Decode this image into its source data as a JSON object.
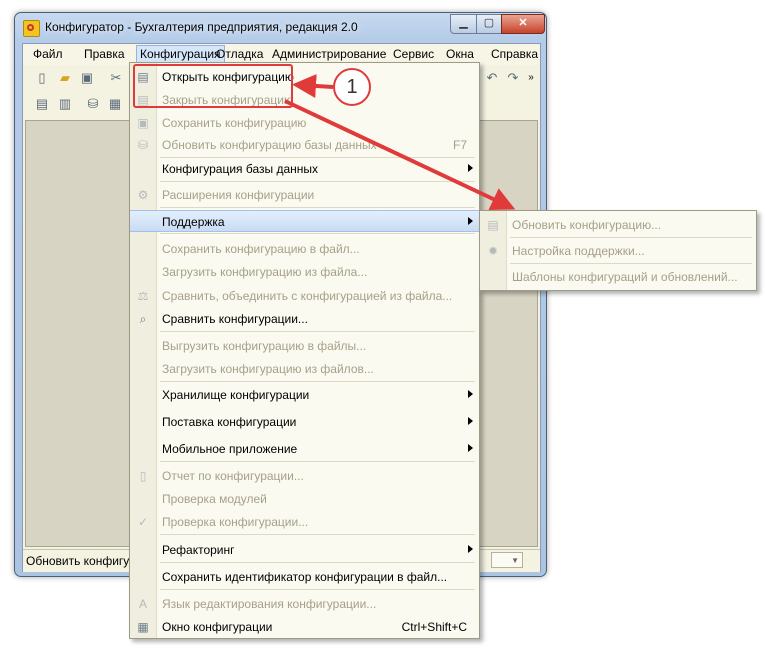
{
  "window": {
    "title": "Конфигуратор - Бухгалтерия предприятия, редакция 2.0"
  },
  "menubar": [
    {
      "label": "Файл",
      "active": false
    },
    {
      "label": "Правка",
      "active": false
    },
    {
      "label": "Конфигурация",
      "active": true
    },
    {
      "label": "Отладка",
      "active": false
    },
    {
      "label": "Администрирование",
      "active": false
    },
    {
      "label": "Сервис",
      "active": false
    },
    {
      "label": "Окна",
      "active": false
    },
    {
      "label": "Справка",
      "active": false
    }
  ],
  "config_menu": {
    "items": [
      {
        "label": "Открыть конфигурацию",
        "disabled": false,
        "icon": "open-config-icon",
        "glyph": "▤"
      },
      {
        "label": "Закрыть конфигурацию",
        "disabled": true,
        "icon": "close-config-icon",
        "glyph": "▤"
      },
      {
        "label": "Сохранить конфигурацию",
        "disabled": true,
        "icon": "save-config-icon",
        "glyph": "▣"
      },
      {
        "label": "Обновить конфигурацию базы данных",
        "disabled": true,
        "icon": "update-db-icon",
        "glyph": "⛁",
        "shortcut": "F7"
      },
      {
        "label": "Конфигурация базы данных",
        "disabled": false,
        "submenu": true
      },
      {
        "label": "Расширения конфигурации",
        "disabled": true,
        "icon": "extensions-icon",
        "glyph": "⚙"
      },
      {
        "label": "Поддержка",
        "disabled": false,
        "highlighted": true,
        "submenu": true
      },
      {
        "label": "Сохранить конфигурацию в файл...",
        "disabled": true
      },
      {
        "label": "Загрузить конфигурацию из файла...",
        "disabled": true
      },
      {
        "label": "Сравнить, объединить с конфигурацией из файла...",
        "disabled": true,
        "icon": "compare-merge-icon",
        "glyph": "⚖"
      },
      {
        "label": "Сравнить конфигурации...",
        "disabled": false,
        "icon": "compare-icon",
        "glyph": "⌕"
      },
      {
        "label": "Выгрузить конфигурацию в файлы...",
        "disabled": true
      },
      {
        "label": "Загрузить конфигурацию из файлов...",
        "disabled": true
      },
      {
        "label": "Хранилище конфигурации",
        "disabled": false,
        "submenu": true
      },
      {
        "label": "Поставка конфигурации",
        "disabled": false,
        "submenu": true
      },
      {
        "label": "Мобильное приложение",
        "disabled": false,
        "submenu": true
      },
      {
        "label": "Отчет по конфигурации...",
        "disabled": true,
        "icon": "report-icon",
        "glyph": "▯"
      },
      {
        "label": "Проверка модулей",
        "disabled": true
      },
      {
        "label": "Проверка конфигурации...",
        "disabled": true,
        "icon": "check-icon",
        "glyph": "✓"
      },
      {
        "label": "Рефакторинг",
        "disabled": false,
        "submenu": true
      },
      {
        "label": "Сохранить идентификатор конфигурации в файл...",
        "disabled": false
      },
      {
        "label": "Язык редактирования конфигурации...",
        "disabled": true,
        "icon": "language-icon",
        "glyph": "A"
      },
      {
        "label": "Окно конфигурации",
        "disabled": false,
        "icon": "config-window-icon",
        "glyph": "▦",
        "shortcut": "Ctrl+Shift+C"
      }
    ]
  },
  "support_submenu": {
    "items": [
      {
        "label": "Обновить конфигурацию...",
        "disabled": true,
        "icon": "update-config-icon",
        "glyph": "▤"
      },
      {
        "label": "Настройка поддержки...",
        "disabled": true,
        "icon": "support-settings-icon",
        "glyph": "✹"
      },
      {
        "label": "Шаблоны конфигураций и обновлений...",
        "disabled": true
      }
    ]
  },
  "statusbar": {
    "text": "Обновить конфигурацию"
  },
  "callout": {
    "number": "1"
  },
  "colors": {
    "annotation_red": "#e03a3a",
    "highlight_blue": "#c9dcf5",
    "menu_bg": "#fbfaf0"
  }
}
